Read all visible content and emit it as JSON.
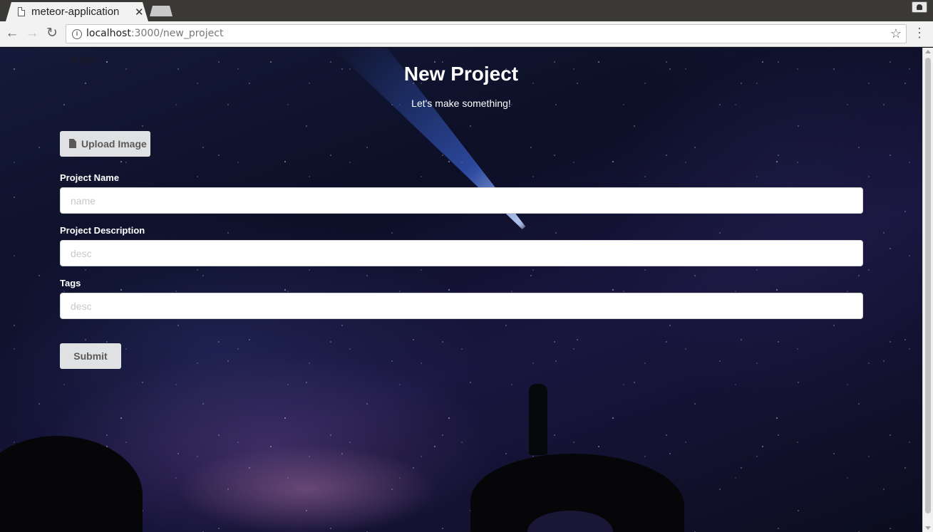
{
  "browser": {
    "tab_title": "meteor-application",
    "url_host": "localhost",
    "url_path": ":3000/new_project"
  },
  "page": {
    "nav_link": "Profile",
    "title": "New Project",
    "subtitle": "Let's make something!",
    "upload_button": "Upload Image",
    "fields": [
      {
        "label": "Project Name",
        "placeholder": "name"
      },
      {
        "label": "Project Description",
        "placeholder": "desc"
      },
      {
        "label": "Tags",
        "placeholder": "desc"
      }
    ],
    "submit_button": "Submit"
  },
  "icons": {
    "tab": "file-icon",
    "upload": "file-icon",
    "address": "info-icon",
    "bookmark": "star-icon",
    "menu": "more-vertical-icon"
  },
  "colors": {
    "button_bg": "#e0e1e2",
    "button_text": "#5a5a5a",
    "text_on_bg": "#ffffff"
  }
}
